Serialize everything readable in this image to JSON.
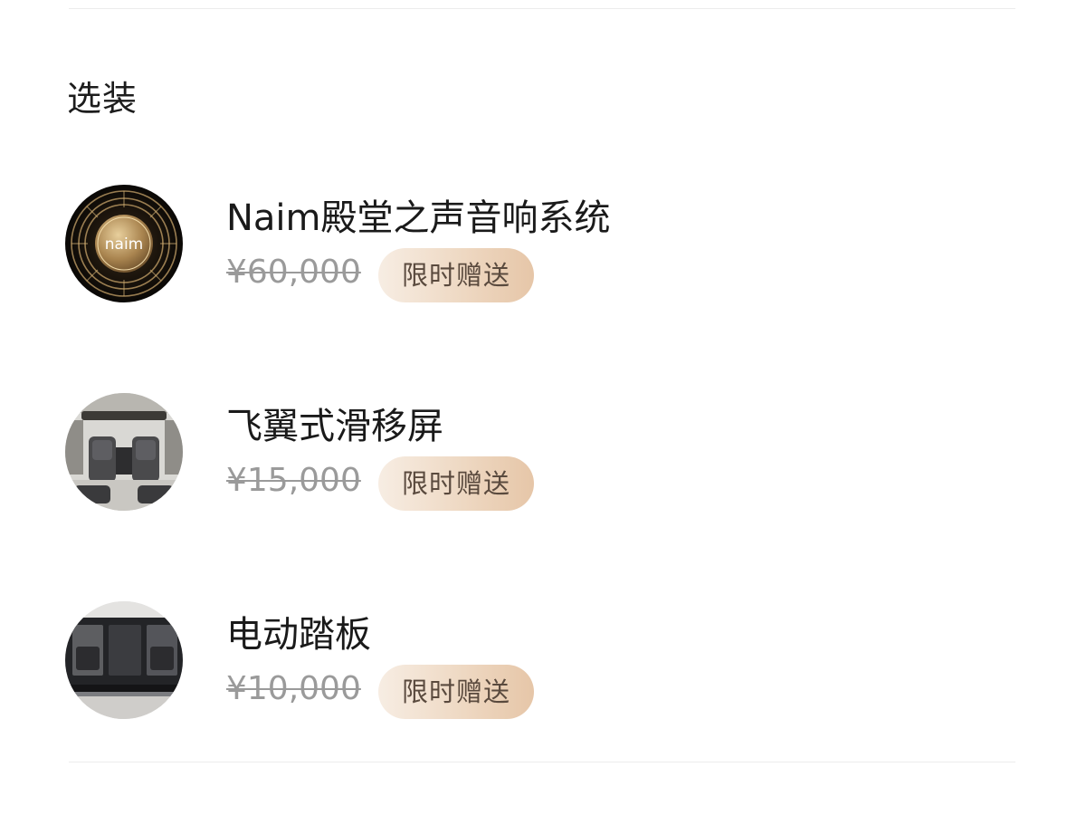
{
  "section": {
    "title": "选装"
  },
  "options": [
    {
      "title": "Naim殿堂之声音响系统",
      "price": "¥60,000",
      "badge": "限时赠送",
      "logo_text": "naim",
      "image_icon": "naim-speaker-grille"
    },
    {
      "title": "飞翼式滑移屏",
      "price": "¥15,000",
      "badge": "限时赠送",
      "image_icon": "car-interior-screen"
    },
    {
      "title": "电动踏板",
      "price": "¥10,000",
      "badge": "限时赠送",
      "image_icon": "car-side-running-board"
    }
  ],
  "colors": {
    "badge_gradient_start": "#f7ede3",
    "badge_gradient_end": "#e6c6a8",
    "badge_text": "#5a4a3e",
    "price_strikethrough": "#9a9a9a"
  }
}
